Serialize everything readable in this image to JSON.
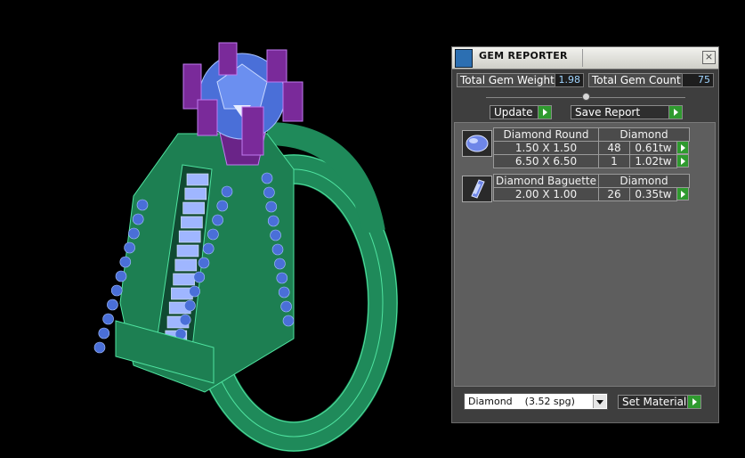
{
  "panel": {
    "title": "GEM REPORTER",
    "close_glyph": "×",
    "total_weight_label": "Total Gem Weight",
    "total_weight_value": "1.98",
    "total_count_label": "Total Gem Count",
    "total_count_value": "75",
    "update_label": "Update",
    "save_report_label": "Save Report",
    "groups": [
      {
        "name": "Diamond Round",
        "material": "Diamond",
        "icon": "round-gem-icon",
        "rows": [
          {
            "size": "1.50 X 1.50",
            "count": "48",
            "weight": "0.61tw"
          },
          {
            "size": "6.50 X 6.50",
            "count": "1",
            "weight": "1.02tw"
          }
        ]
      },
      {
        "name": "Diamond Baguette",
        "material": "Diamond",
        "icon": "baguette-gem-icon",
        "rows": [
          {
            "size": "2.00 X 1.00",
            "count": "26",
            "weight": "0.35tw"
          }
        ]
      }
    ],
    "material_select_value": "Diamond    (3.52 spg)",
    "set_material_label": "Set Material"
  },
  "colors": {
    "band": "#1f8a5a",
    "prongs": "#7a2a9a",
    "stones": "#4a6fd8"
  }
}
